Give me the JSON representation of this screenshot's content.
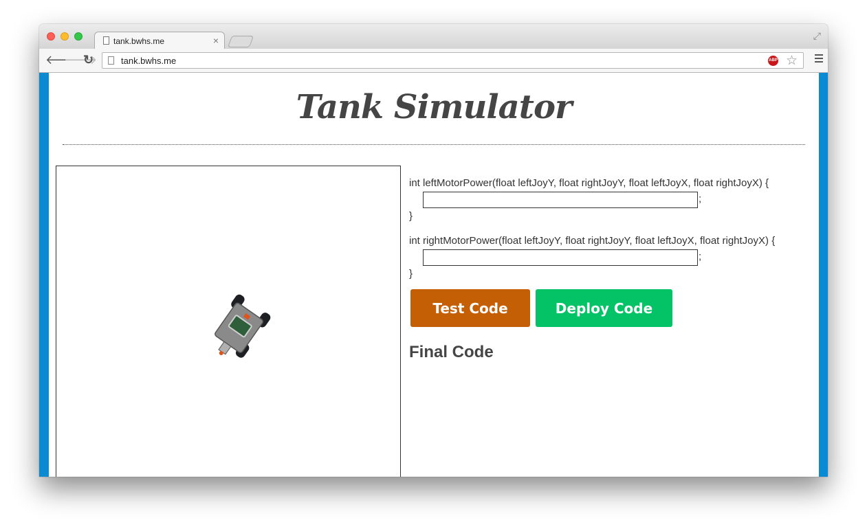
{
  "window": {
    "tab_title": "tank.bwhs.me",
    "tab_close": "×",
    "url": "tank.bwhs.me"
  },
  "toolbar": {
    "back_icon": "🡐",
    "forward_icon": "🡒",
    "reload_icon": "↻",
    "abp_label": "ABP",
    "star_icon": "☆",
    "expand_icon": "⤢"
  },
  "page": {
    "title": "Tank Simulator",
    "functions": [
      {
        "signature": "int leftMotorPower(float leftJoyY, float rightJoyY, float leftJoyX, float rightJoyX) {",
        "value": "",
        "terminator": ";",
        "close": "}"
      },
      {
        "signature": "int rightMotorPower(float leftJoyY, float rightJoyY, float leftJoyX, float rightJoyX) {",
        "value": "",
        "terminator": ";",
        "close": "}"
      }
    ],
    "test_button": "Test Code",
    "deploy_button": "Deploy Code",
    "final_heading": "Final Code"
  },
  "colors": {
    "page_border": "#0a8ad3",
    "test_button": "#c55f06",
    "deploy_button": "#04c366",
    "title_text": "#454545"
  }
}
